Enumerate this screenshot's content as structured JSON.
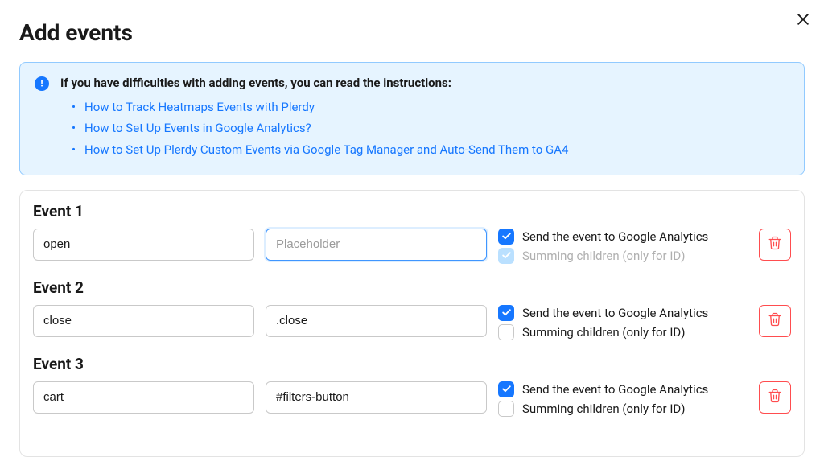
{
  "modal": {
    "title": "Add events"
  },
  "info": {
    "heading": "If you have difficulties with adding events, you can read the instructions:",
    "links": [
      "How to Track Heatmaps Events with Plerdy",
      "How to Set Up Events in Google Analytics?",
      "How to Set Up Plerdy Custom Events via Google Tag Manager and Auto-Send Them to GA4"
    ]
  },
  "labels": {
    "send_ga": "Send the event to Google Analytics",
    "summing": "Summing children (only for ID)",
    "selector_placeholder": "Placeholder"
  },
  "events": [
    {
      "title": "Event 1",
      "name": "open",
      "selector": "",
      "focused": true,
      "ga_checked": true,
      "sum_checked": true,
      "sum_disabled": true
    },
    {
      "title": "Event 2",
      "name": "close",
      "selector": ".close",
      "focused": false,
      "ga_checked": true,
      "sum_checked": false,
      "sum_disabled": false
    },
    {
      "title": "Event 3",
      "name": "cart",
      "selector": "#filters-button",
      "focused": false,
      "ga_checked": true,
      "sum_checked": false,
      "sum_disabled": false
    }
  ]
}
